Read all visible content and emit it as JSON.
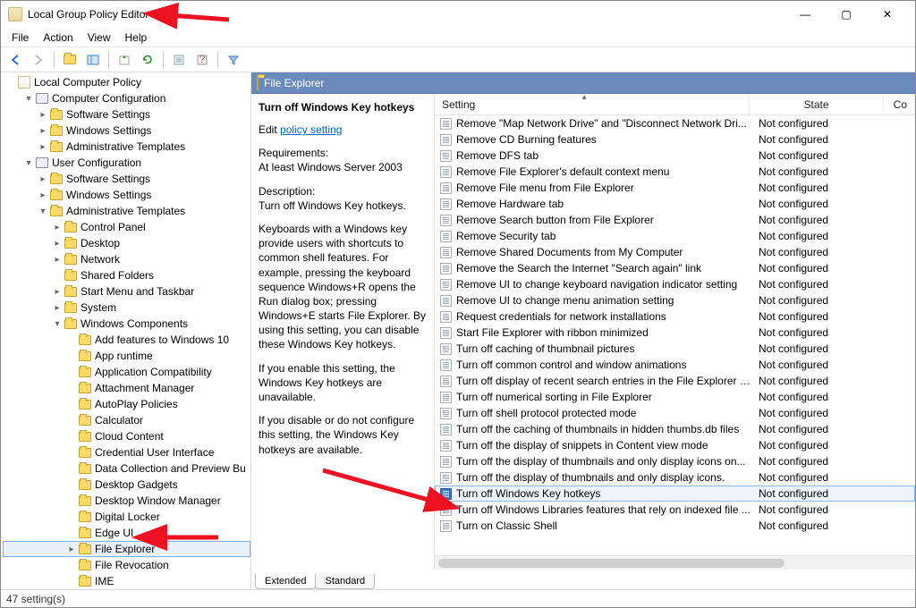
{
  "window": {
    "title": "Local Group Policy Editor",
    "minimize": "—",
    "maximize": "▢",
    "close": "✕"
  },
  "menubar": [
    "File",
    "Action",
    "View",
    "Help"
  ],
  "tree": {
    "root": "Local Computer Policy",
    "nodes": [
      {
        "d": 0,
        "exp": "▾",
        "icon": "pc",
        "label": "Computer Configuration"
      },
      {
        "d": 1,
        "exp": "▸",
        "icon": "f",
        "label": "Software Settings"
      },
      {
        "d": 1,
        "exp": "▸",
        "icon": "f",
        "label": "Windows Settings"
      },
      {
        "d": 1,
        "exp": "▸",
        "icon": "f",
        "label": "Administrative Templates"
      },
      {
        "d": 0,
        "exp": "▾",
        "icon": "pc",
        "label": "User Configuration"
      },
      {
        "d": 1,
        "exp": "▸",
        "icon": "f",
        "label": "Software Settings"
      },
      {
        "d": 1,
        "exp": "▸",
        "icon": "f",
        "label": "Windows Settings"
      },
      {
        "d": 1,
        "exp": "▾",
        "icon": "f",
        "label": "Administrative Templates"
      },
      {
        "d": 2,
        "exp": "▸",
        "icon": "f",
        "label": "Control Panel"
      },
      {
        "d": 2,
        "exp": "▸",
        "icon": "f",
        "label": "Desktop"
      },
      {
        "d": 2,
        "exp": "▸",
        "icon": "f",
        "label": "Network"
      },
      {
        "d": 2,
        "exp": "",
        "icon": "f",
        "label": "Shared Folders"
      },
      {
        "d": 2,
        "exp": "▸",
        "icon": "f",
        "label": "Start Menu and Taskbar"
      },
      {
        "d": 2,
        "exp": "▸",
        "icon": "f",
        "label": "System"
      },
      {
        "d": 2,
        "exp": "▾",
        "icon": "f",
        "label": "Windows Components"
      },
      {
        "d": 3,
        "exp": "",
        "icon": "f",
        "label": "Add features to Windows 10"
      },
      {
        "d": 3,
        "exp": "",
        "icon": "f",
        "label": "App runtime"
      },
      {
        "d": 3,
        "exp": "",
        "icon": "f",
        "label": "Application Compatibility"
      },
      {
        "d": 3,
        "exp": "",
        "icon": "f",
        "label": "Attachment Manager"
      },
      {
        "d": 3,
        "exp": "",
        "icon": "f",
        "label": "AutoPlay Policies"
      },
      {
        "d": 3,
        "exp": "",
        "icon": "f",
        "label": "Calculator"
      },
      {
        "d": 3,
        "exp": "",
        "icon": "f",
        "label": "Cloud Content"
      },
      {
        "d": 3,
        "exp": "",
        "icon": "f",
        "label": "Credential User Interface"
      },
      {
        "d": 3,
        "exp": "",
        "icon": "f",
        "label": "Data Collection and Preview Bu"
      },
      {
        "d": 3,
        "exp": "",
        "icon": "f",
        "label": "Desktop Gadgets"
      },
      {
        "d": 3,
        "exp": "",
        "icon": "f",
        "label": "Desktop Window Manager"
      },
      {
        "d": 3,
        "exp": "",
        "icon": "f",
        "label": "Digital Locker"
      },
      {
        "d": 3,
        "exp": "",
        "icon": "f",
        "label": "Edge UI"
      },
      {
        "d": 3,
        "exp": "▸",
        "icon": "f",
        "label": "File Explorer",
        "sel": true
      },
      {
        "d": 3,
        "exp": "",
        "icon": "f",
        "label": "File Revocation"
      },
      {
        "d": 3,
        "exp": "",
        "icon": "f",
        "label": "IME"
      }
    ]
  },
  "content": {
    "headerTitle": "File Explorer",
    "selectedSetting": "Turn off Windows Key hotkeys",
    "editPrefix": "Edit ",
    "editLink": "policy setting ",
    "reqLabel": "Requirements:",
    "reqText": "At least Windows Server 2003",
    "descLabel": "Description:",
    "descShort": "Turn off Windows Key hotkeys.",
    "descLong1": "Keyboards with a Windows key provide users with shortcuts to common shell features. For example, pressing the keyboard sequence Windows+R opens the Run dialog box; pressing Windows+E starts File Explorer. By using this setting, you can disable these Windows Key hotkeys.",
    "descLong2": "If you enable this setting, the Windows Key hotkeys are unavailable.",
    "descLong3": "If you disable or do not configure this setting, the Windows Key hotkeys are available.",
    "columns": {
      "setting": "Setting",
      "state": "State",
      "comment": "Co"
    },
    "settings": [
      {
        "name": "Remove \"Map Network Drive\" and \"Disconnect Network Dri...",
        "state": "Not configured"
      },
      {
        "name": "Remove CD Burning features",
        "state": "Not configured"
      },
      {
        "name": "Remove DFS tab",
        "state": "Not configured"
      },
      {
        "name": "Remove File Explorer's default context menu",
        "state": "Not configured"
      },
      {
        "name": "Remove File menu from File Explorer",
        "state": "Not configured"
      },
      {
        "name": "Remove Hardware tab",
        "state": "Not configured"
      },
      {
        "name": "Remove Search button from File Explorer",
        "state": "Not configured"
      },
      {
        "name": "Remove Security tab",
        "state": "Not configured"
      },
      {
        "name": "Remove Shared Documents from My Computer",
        "state": "Not configured"
      },
      {
        "name": "Remove the Search the Internet \"Search again\" link",
        "state": "Not configured"
      },
      {
        "name": "Remove UI to change keyboard navigation indicator setting",
        "state": "Not configured"
      },
      {
        "name": "Remove UI to change menu animation setting",
        "state": "Not configured"
      },
      {
        "name": "Request credentials for network installations",
        "state": "Not configured"
      },
      {
        "name": "Start File Explorer with ribbon minimized",
        "state": "Not configured"
      },
      {
        "name": "Turn off caching of thumbnail pictures",
        "state": "Not configured"
      },
      {
        "name": "Turn off common control and window animations",
        "state": "Not configured"
      },
      {
        "name": "Turn off display of recent search entries in the File Explorer s...",
        "state": "Not configured"
      },
      {
        "name": "Turn off numerical sorting in File Explorer",
        "state": "Not configured"
      },
      {
        "name": "Turn off shell protocol protected mode",
        "state": "Not configured"
      },
      {
        "name": "Turn off the caching of thumbnails in hidden thumbs.db files",
        "state": "Not configured"
      },
      {
        "name": "Turn off the display of snippets in Content view mode",
        "state": "Not configured"
      },
      {
        "name": "Turn off the display of thumbnails and only display icons on...",
        "state": "Not configured"
      },
      {
        "name": "Turn off the display of thumbnails and only display icons.",
        "state": "Not configured"
      },
      {
        "name": "Turn off Windows Key hotkeys",
        "state": "Not configured",
        "sel": true
      },
      {
        "name": "Turn off Windows Libraries features that rely on indexed file ...",
        "state": "Not configured"
      },
      {
        "name": "Turn on Classic Shell",
        "state": "Not configured"
      }
    ],
    "tabs": {
      "extended": "Extended",
      "standard": "Standard"
    }
  },
  "status": "47 setting(s)"
}
